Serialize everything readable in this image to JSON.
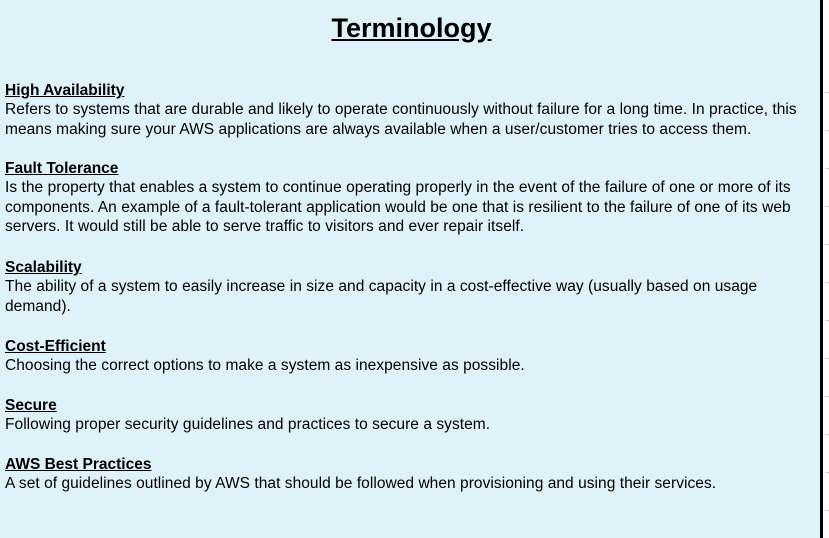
{
  "page": {
    "title": "Terminology"
  },
  "terms": [
    {
      "heading": "High Availability",
      "description": "Refers to systems that are durable and likely to operate continuously without failure for a long time. In practice, this means making sure your AWS applications are always available when a user/customer tries to access them."
    },
    {
      "heading": "Fault Tolerance",
      "description": "Is the property that enables a system to continue operating properly in the event of the failure of one or more of its components. An example of a fault-tolerant application would be one that is resilient to the failure of one of its web servers. It would still be able to serve traffic to visitors and ever repair itself."
    },
    {
      "heading": "Scalability",
      "description": "The ability of a system to easily increase in size and capacity in a cost-effective way (usually based on usage demand)."
    },
    {
      "heading": "Cost-Efficient",
      "description": "Choosing the correct options to make a system as inexpensive as possible."
    },
    {
      "heading": "Secure",
      "description": "Following proper security guidelines and practices to secure a system."
    },
    {
      "heading": "AWS Best Practices",
      "description": "A set of guidelines outlined by AWS that should be followed when provisioning and using their services."
    }
  ],
  "colors": {
    "background": "#dff2fa",
    "text": "#000000"
  }
}
